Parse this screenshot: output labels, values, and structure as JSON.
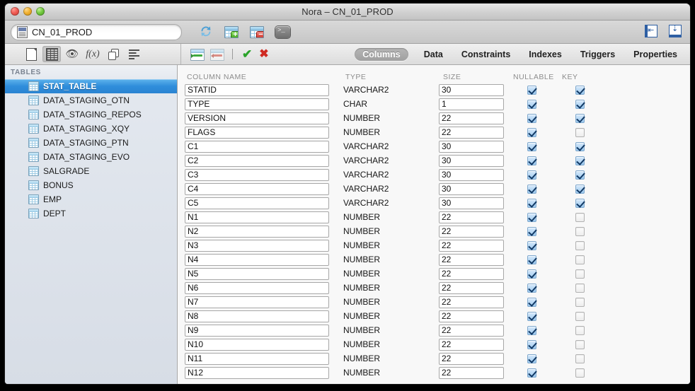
{
  "window": {
    "title": "Nora – CN_01_PROD",
    "traffic_lights": [
      "close",
      "minimize",
      "zoom"
    ]
  },
  "connection_bar": {
    "connection_name": "CN_01_PROD",
    "icons": [
      {
        "name": "refresh-icon",
        "label": "Refresh"
      },
      {
        "name": "add-table-icon",
        "label": "Add Table"
      },
      {
        "name": "drop-table-icon",
        "label": "Drop Table"
      },
      {
        "name": "console-icon",
        "label": "SQL Console"
      }
    ],
    "panel_buttons": [
      {
        "name": "toggle-left-panel-icon",
        "label": "Toggle Left Panel"
      },
      {
        "name": "toggle-bottom-panel-icon",
        "label": "Toggle Bottom Panel"
      }
    ]
  },
  "toolbar": {
    "left_icons": [
      {
        "name": "new-document-icon",
        "label": "New",
        "active": false
      },
      {
        "name": "table-view-icon",
        "label": "Table View",
        "active": true
      },
      {
        "name": "view-eye-icon",
        "label": "View",
        "active": false
      },
      {
        "name": "function-icon",
        "label": "Function",
        "active": false
      },
      {
        "name": "duplicate-icon",
        "label": "Duplicate",
        "active": false
      },
      {
        "name": "list-lines-icon",
        "label": "Details",
        "active": false
      }
    ],
    "right_icons": [
      {
        "name": "add-row-icon",
        "label": "Add Column"
      },
      {
        "name": "delete-row-icon",
        "label": "Delete Column"
      },
      {
        "name": "apply-check-icon",
        "label": "Apply"
      },
      {
        "name": "revert-x-icon",
        "label": "Revert"
      }
    ]
  },
  "tabs": [
    {
      "label": "Columns",
      "selected": true
    },
    {
      "label": "Data",
      "selected": false
    },
    {
      "label": "Constraints",
      "selected": false
    },
    {
      "label": "Indexes",
      "selected": false
    },
    {
      "label": "Triggers",
      "selected": false
    },
    {
      "label": "Properties",
      "selected": false
    }
  ],
  "sidebar": {
    "header": "TABLES",
    "items": [
      {
        "label": "STAT_TABLE",
        "selected": true
      },
      {
        "label": "DATA_STAGING_OTN",
        "selected": false
      },
      {
        "label": "DATA_STAGING_REPOS",
        "selected": false
      },
      {
        "label": "DATA_STAGING_XQY",
        "selected": false
      },
      {
        "label": "DATA_STAGING_PTN",
        "selected": false
      },
      {
        "label": "DATA_STAGING_EVO",
        "selected": false
      },
      {
        "label": "SALGRADE",
        "selected": false
      },
      {
        "label": "BONUS",
        "selected": false
      },
      {
        "label": "EMP",
        "selected": false
      },
      {
        "label": "DEPT",
        "selected": false
      }
    ]
  },
  "columns_table": {
    "headers": {
      "name": "COLUMN NAME",
      "type": "TYPE",
      "size": "SIZE",
      "nullable": "NULLABLE",
      "key": "KEY"
    },
    "rows": [
      {
        "name": "STATID",
        "type": "VARCHAR2",
        "size": "30",
        "nullable": true,
        "key": true
      },
      {
        "name": "TYPE",
        "type": "CHAR",
        "size": "1",
        "nullable": true,
        "key": true
      },
      {
        "name": "VERSION",
        "type": "NUMBER",
        "size": "22",
        "nullable": true,
        "key": true
      },
      {
        "name": "FLAGS",
        "type": "NUMBER",
        "size": "22",
        "nullable": true,
        "key": false
      },
      {
        "name": "C1",
        "type": "VARCHAR2",
        "size": "30",
        "nullable": true,
        "key": true
      },
      {
        "name": "C2",
        "type": "VARCHAR2",
        "size": "30",
        "nullable": true,
        "key": true
      },
      {
        "name": "C3",
        "type": "VARCHAR2",
        "size": "30",
        "nullable": true,
        "key": true
      },
      {
        "name": "C4",
        "type": "VARCHAR2",
        "size": "30",
        "nullable": true,
        "key": true
      },
      {
        "name": "C5",
        "type": "VARCHAR2",
        "size": "30",
        "nullable": true,
        "key": true
      },
      {
        "name": "N1",
        "type": "NUMBER",
        "size": "22",
        "nullable": true,
        "key": false
      },
      {
        "name": "N2",
        "type": "NUMBER",
        "size": "22",
        "nullable": true,
        "key": false
      },
      {
        "name": "N3",
        "type": "NUMBER",
        "size": "22",
        "nullable": true,
        "key": false
      },
      {
        "name": "N4",
        "type": "NUMBER",
        "size": "22",
        "nullable": true,
        "key": false
      },
      {
        "name": "N5",
        "type": "NUMBER",
        "size": "22",
        "nullable": true,
        "key": false
      },
      {
        "name": "N6",
        "type": "NUMBER",
        "size": "22",
        "nullable": true,
        "key": false
      },
      {
        "name": "N7",
        "type": "NUMBER",
        "size": "22",
        "nullable": true,
        "key": false
      },
      {
        "name": "N8",
        "type": "NUMBER",
        "size": "22",
        "nullable": true,
        "key": false
      },
      {
        "name": "N9",
        "type": "NUMBER",
        "size": "22",
        "nullable": true,
        "key": false
      },
      {
        "name": "N10",
        "type": "NUMBER",
        "size": "22",
        "nullable": true,
        "key": false
      },
      {
        "name": "N11",
        "type": "NUMBER",
        "size": "22",
        "nullable": true,
        "key": false
      },
      {
        "name": "N12",
        "type": "NUMBER",
        "size": "22",
        "nullable": true,
        "key": false
      }
    ]
  },
  "colors": {
    "selection_blue": "#2f8ddb",
    "sidebar_bg": "#d7dde6",
    "checkbox_on": "#9cc8ee",
    "accent_green": "#2aa32a",
    "accent_red": "#cf2a22"
  }
}
